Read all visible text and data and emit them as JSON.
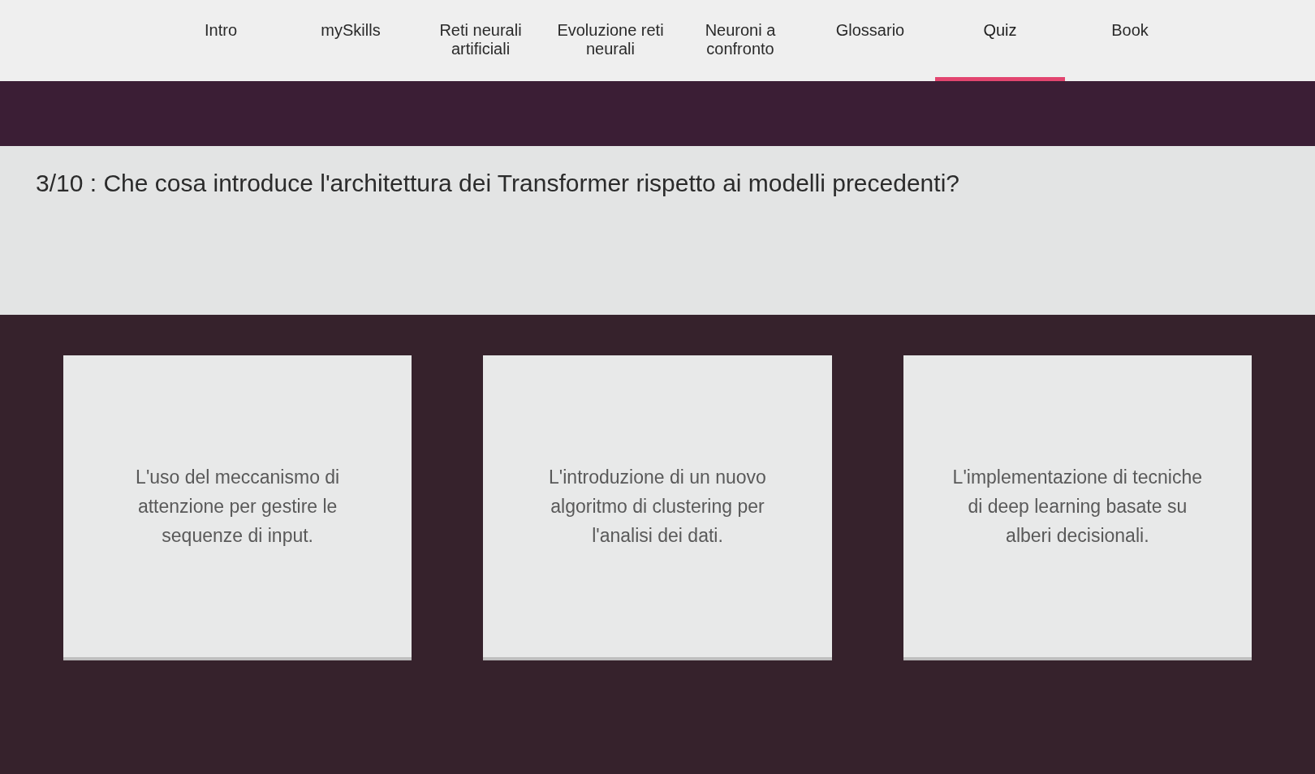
{
  "nav": {
    "items": [
      {
        "label": "Intro",
        "selected": false
      },
      {
        "label": "mySkills",
        "selected": false
      },
      {
        "label": "Reti neurali artificiali",
        "selected": false
      },
      {
        "label": "Evoluzione reti neurali",
        "selected": false
      },
      {
        "label": "Neuroni a confronto",
        "selected": false
      },
      {
        "label": "Glossario",
        "selected": false
      },
      {
        "label": "Quiz",
        "selected": true
      },
      {
        "label": "Book",
        "selected": false
      }
    ]
  },
  "question": {
    "text": "3/10 : Che cosa introduce l'architettura dei Transformer rispetto ai modelli precedenti?"
  },
  "answers": [
    {
      "text": "L'uso del meccanismo di attenzione per gestire le sequenze di input.",
      "selected": false
    },
    {
      "text": "L'introduzione di un nuovo algoritmo di clustering per l'analisi dei dati.",
      "selected": false
    },
    {
      "text": "L'implementazione di tecniche di deep learning basate su alberi decisionali.",
      "selected": false
    }
  ]
}
